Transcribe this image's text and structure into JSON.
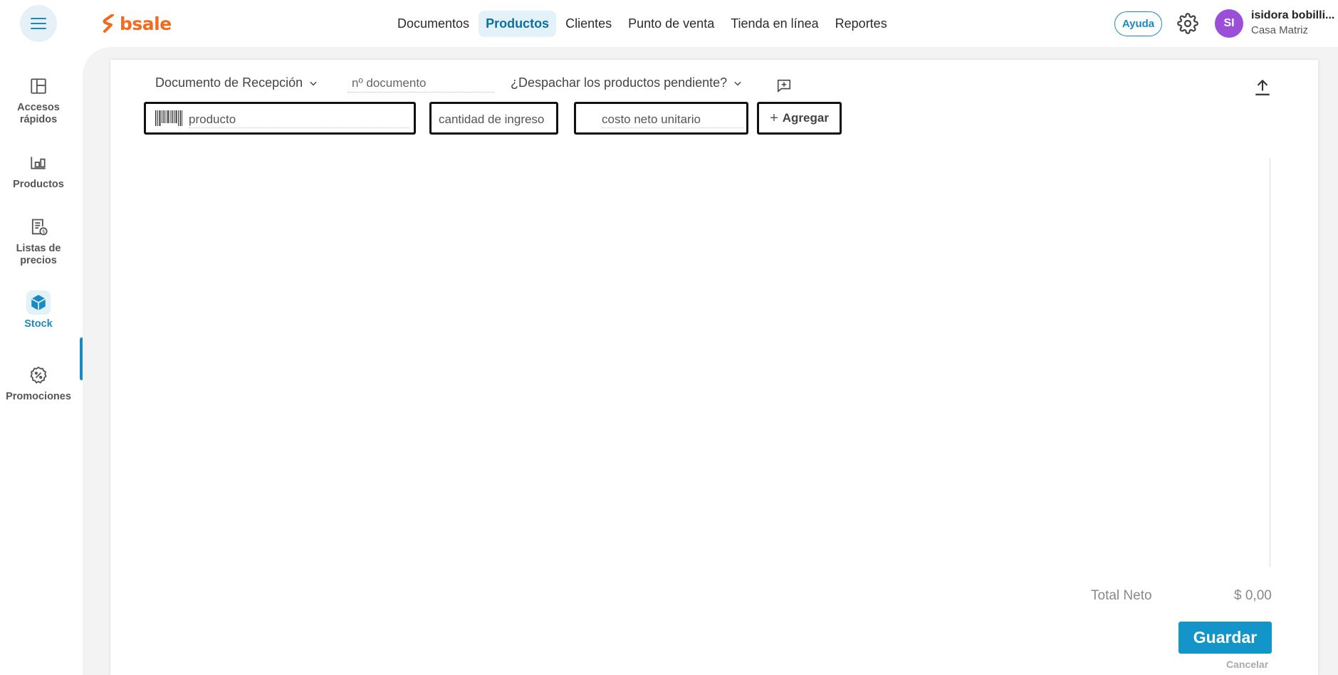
{
  "brand": {
    "name": "bsale",
    "color": "#f26a1b"
  },
  "header": {
    "nav": [
      {
        "label": "Documentos",
        "active": false
      },
      {
        "label": "Productos",
        "active": true
      },
      {
        "label": "Clientes",
        "active": false
      },
      {
        "label": "Punto de venta",
        "active": false
      },
      {
        "label": "Tienda en línea",
        "active": false
      },
      {
        "label": "Reportes",
        "active": false
      }
    ],
    "help_label": "Ayuda",
    "settings_icon": "gear-icon",
    "user": {
      "initials": "SI",
      "name": "isidora bobilli...",
      "branch": "Casa Matriz",
      "avatar_color": "#9b4fd8"
    }
  },
  "sidebar": {
    "items": [
      {
        "label": "Accesos rápidos",
        "icon": "layout-icon",
        "active": false
      },
      {
        "label": "Productos",
        "icon": "products-icon",
        "active": false
      },
      {
        "label": "Listas de precios",
        "icon": "price-list-icon",
        "active": false
      },
      {
        "label": "Stock",
        "icon": "cube-icon",
        "active": true
      },
      {
        "label": "Promociones",
        "icon": "promotion-icon",
        "active": false
      }
    ]
  },
  "form": {
    "document_type": "Documento de Recepción",
    "document_number_placeholder": "nº documento",
    "dispatch_question": "¿Despachar los productos pendiente?",
    "product_placeholder": "producto",
    "quantity_placeholder": "cantidad de ingreso",
    "cost_placeholder": "costo neto unitario",
    "add_label": "Agregar"
  },
  "footer": {
    "total_label": "Total Neto",
    "total_value": "$ 0,00",
    "save_label": "Guardar",
    "cancel_label": "Cancelar"
  },
  "colors": {
    "accent": "#1395c9",
    "active_bg": "#e3f1f8"
  }
}
